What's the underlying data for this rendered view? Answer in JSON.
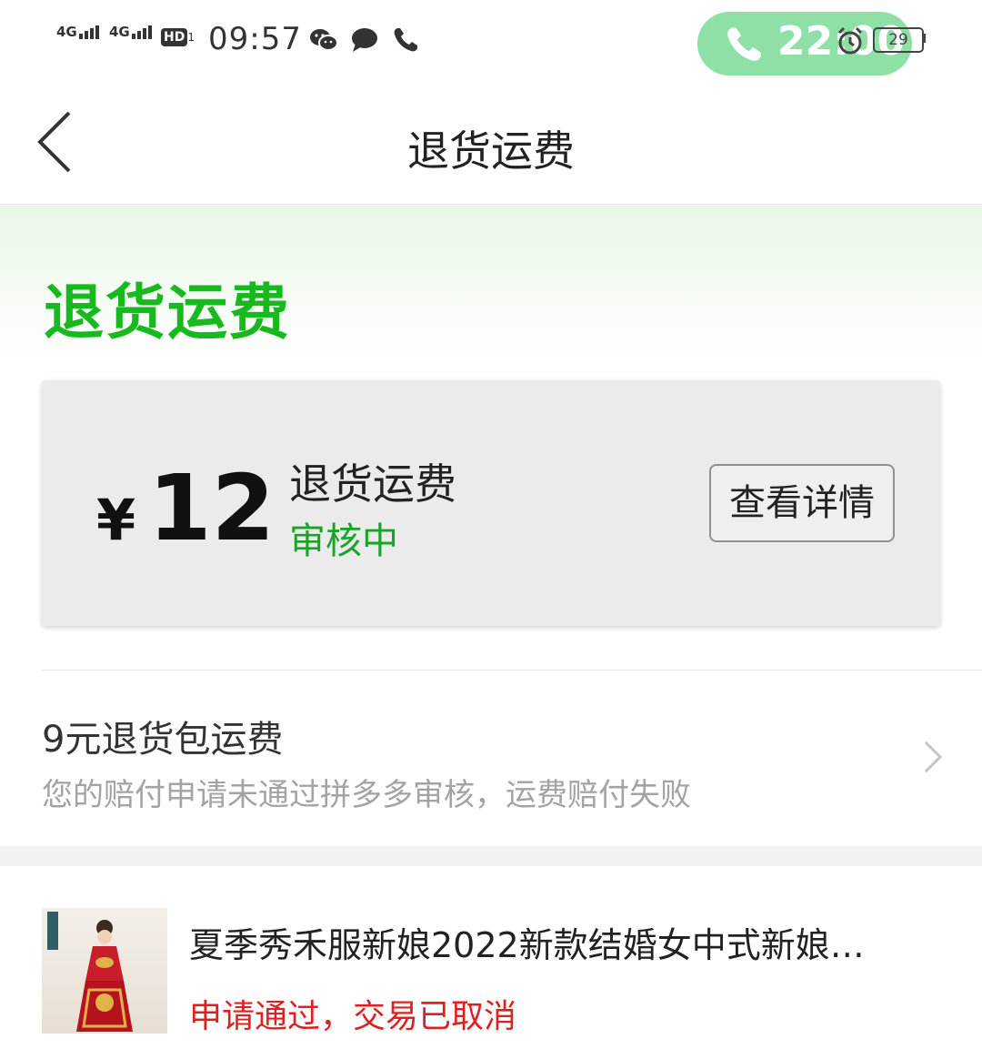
{
  "status_bar": {
    "network1": "4G",
    "network2": "4G",
    "hd_label": "HD",
    "hd_sub": "1",
    "time": "09:57",
    "call_timer": "22:00",
    "battery": "29",
    "icons": [
      "wechat-icon",
      "message-icon",
      "phone-icon",
      "alarm-icon"
    ],
    "call_pill_color": "#8ee0a7"
  },
  "nav": {
    "title": "退货运费",
    "back_icon": "back-arrow-icon"
  },
  "hero": {
    "title": "退货运费",
    "accent_color": "#18b81f"
  },
  "refund_card": {
    "currency": "¥",
    "amount": "12",
    "label": "退货运费",
    "status": "审核中",
    "detail_button": "查看详情"
  },
  "insurance_row": {
    "title": "9元退货包运费",
    "subtitle": "您的赔付申请未通过拼多多审核，运费赔付失败",
    "chevron_icon": "chevron-right-icon"
  },
  "product": {
    "title": "夏季秀禾服新娘2022新款结婚女中式新娘…",
    "status": "申请通过，交易已取消",
    "status_color": "#e02020"
  }
}
